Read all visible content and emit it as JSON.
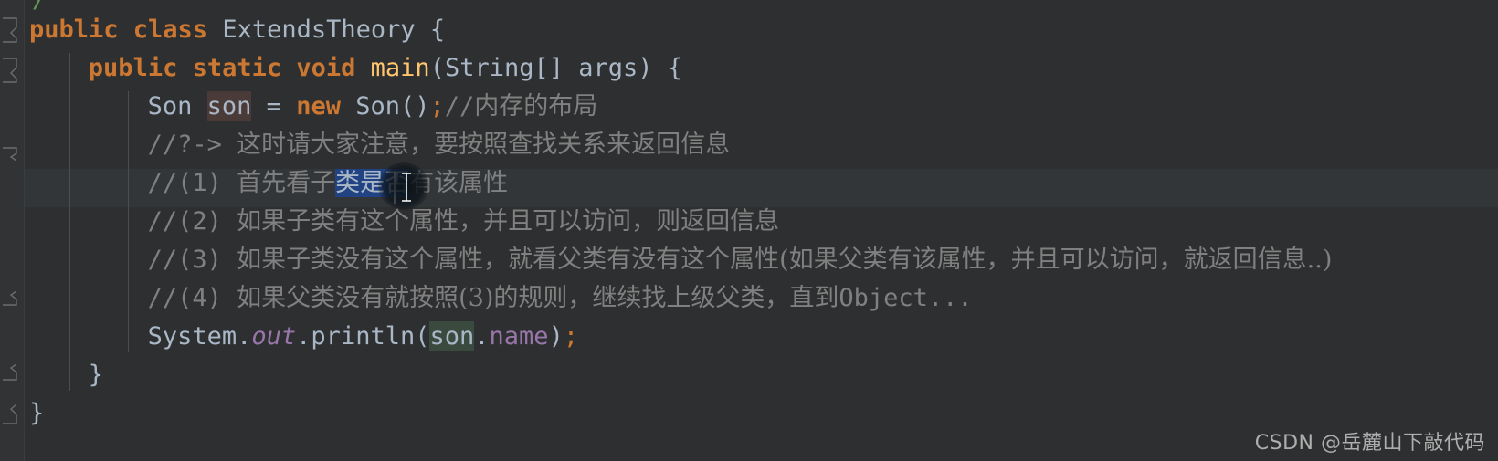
{
  "editor": {
    "language": "java",
    "theme": "darcula",
    "background": "#2e2f30",
    "gutter_background": "#313335",
    "selection_color": "#214283",
    "caret_row_color": "#323639",
    "default_text_color": "#a9b7c6",
    "keyword_color": "#cc7832",
    "comment_color": "#808080",
    "method_color": "#ffc66d",
    "field_color": "#9876aa"
  },
  "top_partial_glyph": "/",
  "lines": [
    {
      "id": "line-class-decl",
      "indent": 0,
      "segments": [
        {
          "cls": "kw",
          "text": "public class "
        },
        {
          "cls": "cls",
          "text": "ExtendsTheory "
        },
        {
          "cls": "plain",
          "text": "{"
        }
      ],
      "plain": "public class ExtendsTheory {"
    },
    {
      "id": "line-main-signature",
      "indent": 1,
      "segments": [
        {
          "cls": "kw",
          "text": "public static void "
        },
        {
          "cls": "fn",
          "text": "main"
        },
        {
          "cls": "plain",
          "text": "(String[] args) {"
        }
      ],
      "plain": "public static void main(String[] args) {"
    },
    {
      "id": "line-son-instantiation",
      "indent": 2,
      "segments": [
        {
          "cls": "cls",
          "text": "Son "
        },
        {
          "cls": "hl-ident",
          "text": "son"
        },
        {
          "cls": "plain",
          "text": " = "
        },
        {
          "cls": "kw",
          "text": "new "
        },
        {
          "cls": "cls",
          "text": "Son()"
        },
        {
          "cls": "semi",
          "text": ";"
        },
        {
          "cls": "cmt",
          "text": "//"
        },
        {
          "cls": "cmt-cn",
          "text": "内存的布局"
        }
      ],
      "plain": "Son son = new Son();//内存的布局"
    },
    {
      "id": "line-comment-question",
      "indent": 2,
      "segments": [
        {
          "cls": "cmt",
          "text": "//?-> "
        },
        {
          "cls": "cmt-cn",
          "text": "这时请大家注意，要按照查找关系来返回信息"
        }
      ],
      "plain": "//?-> 这时请大家注意，要按照查找关系来返回信息"
    },
    {
      "id": "line-comment-step-1",
      "indent": 2,
      "caret_row": true,
      "segments": [
        {
          "cls": "cmt",
          "text": "//(1) "
        },
        {
          "cls": "cmt-cn",
          "text": "首先看子"
        },
        {
          "cls": "cmt-cn sel",
          "text": "类是否"
        },
        {
          "cls": "cmt-cn",
          "text": "有该属性"
        }
      ],
      "plain": "//(1) 首先看子类是否有该属性",
      "selected_text": "类是否"
    },
    {
      "id": "line-comment-step-2",
      "indent": 2,
      "segments": [
        {
          "cls": "cmt",
          "text": "//(2) "
        },
        {
          "cls": "cmt-cn",
          "text": "如果子类有这个属性，并且可以访问，则返回信息"
        }
      ],
      "plain": "//(2) 如果子类有这个属性，并且可以访问，则返回信息"
    },
    {
      "id": "line-comment-step-3",
      "indent": 2,
      "segments": [
        {
          "cls": "cmt",
          "text": "//(3) "
        },
        {
          "cls": "cmt-cn",
          "text": "如果子类没有这个属性，就看父类有没有这个属性(如果父类有该属性，并且可以访问，就返回信息..)"
        }
      ],
      "plain": "//(3) 如果子类没有这个属性，就看父类有没有这个属性(如果父类有该属性，并且可以访问，就返回信息..)"
    },
    {
      "id": "line-comment-step-4",
      "indent": 2,
      "segments": [
        {
          "cls": "cmt",
          "text": "//(4) "
        },
        {
          "cls": "cmt-cn",
          "text": "如果父类没有就按照(3)的规则，继续找上级父类，直到"
        },
        {
          "cls": "cmt",
          "text": "Object..."
        }
      ],
      "plain": "//(4) 如果父类没有就按照(3)的规则，继续找上级父类，直到Object..."
    },
    {
      "id": "line-println",
      "indent": 2,
      "segments": [
        {
          "cls": "cls",
          "text": "System."
        },
        {
          "cls": "field-i",
          "text": "out"
        },
        {
          "cls": "plain",
          "text": ".println("
        },
        {
          "cls": "ident hl-write",
          "text": "son"
        },
        {
          "cls": "plain",
          "text": "."
        },
        {
          "cls": "field",
          "text": "name"
        },
        {
          "cls": "plain",
          "text": ")"
        },
        {
          "cls": "semi",
          "text": ";"
        }
      ],
      "plain": "System.out.println(son.name);"
    },
    {
      "id": "line-close-method",
      "indent": 1,
      "segments": [
        {
          "cls": "plain",
          "text": "}"
        }
      ],
      "plain": "}"
    },
    {
      "id": "line-close-class",
      "indent": 0,
      "segments": [
        {
          "cls": "plain",
          "text": "}"
        }
      ],
      "plain": "}"
    }
  ],
  "watermark": {
    "text": "CSDN @岳麓山下敲代码"
  }
}
